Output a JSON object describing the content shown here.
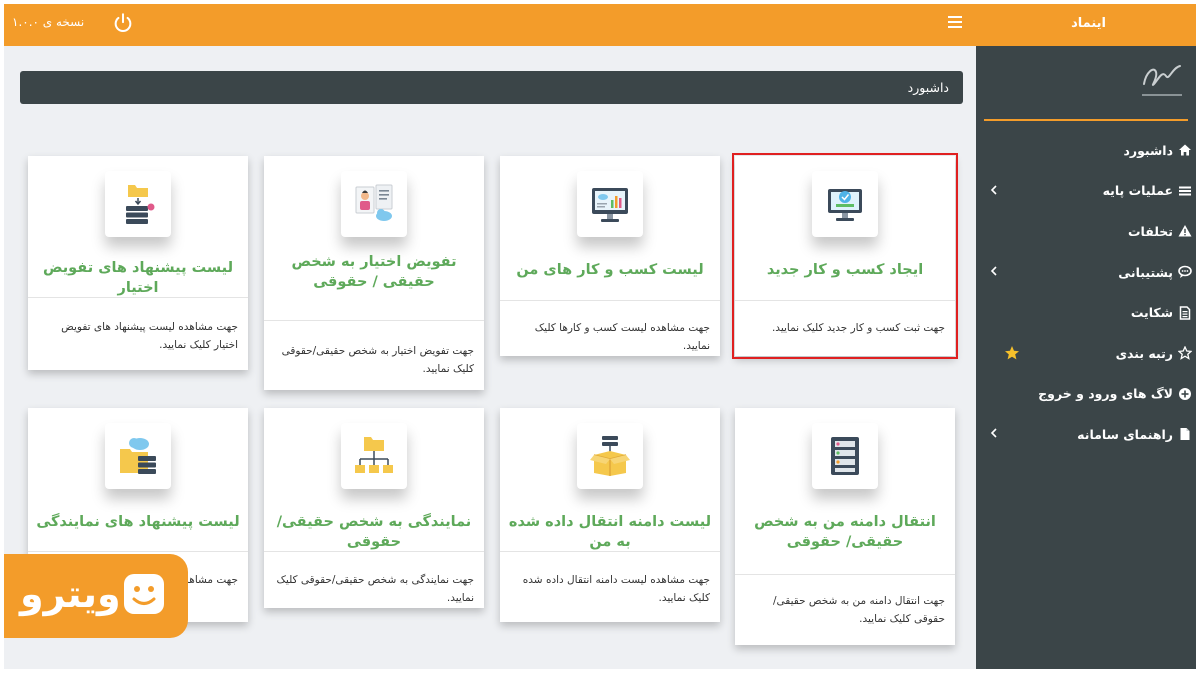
{
  "header": {
    "brand": "اینماد",
    "version": "نسخه ی ۱.۰.۰"
  },
  "sidebar": {
    "items": [
      {
        "label": "داشبورد",
        "icon": "home-icon",
        "has_chevron": false
      },
      {
        "label": "عملیات پایه",
        "icon": "list-icon",
        "has_chevron": true
      },
      {
        "label": "تخلفات",
        "icon": "warning-icon",
        "has_chevron": false
      },
      {
        "label": "پشتیبانی",
        "icon": "chat-icon",
        "has_chevron": true
      },
      {
        "label": "شکایت",
        "icon": "document-icon",
        "has_chevron": false
      },
      {
        "label": "رتبه بندی",
        "icon": "star-outline-icon",
        "has_chevron": false
      },
      {
        "label": "لاگ های ورود و خروج",
        "icon": "plus-circle-icon",
        "has_chevron": false
      },
      {
        "label": "راهنمای سامانه",
        "icon": "file-icon",
        "has_chevron": true
      }
    ]
  },
  "main": {
    "breadcrumb": "داشبورد",
    "cards": [
      {
        "title": "ایجاد کسب و کار جدید",
        "desc": "جهت ثبت کسب و کار جدید کلیک نمایید.",
        "icon": "new-business-monitor-icon"
      },
      {
        "title": "لیست کسب و کار های من",
        "desc": "جهت مشاهده لیست کسب و کارها کلیک نمایید.",
        "icon": "chart-monitor-icon"
      },
      {
        "title": "تفویض اختیار به شخص حقیقی / حقوقی",
        "desc": "جهت تفویض اختیار به شخص حقیقی/حقوقی کلیک نمایید.",
        "icon": "person-document-icon"
      },
      {
        "title": "لیست پیشنهاد های تفویض اختیار",
        "desc": "جهت مشاهده لیست پیشنهاد های تفویض اختیار کلیک نمایید.",
        "icon": "folder-server-icon"
      },
      {
        "title": "انتقال دامنه من به شخص حقیقی/ حقوقی",
        "desc": "جهت انتقال دامنه من به شخص حقیقی/حقوقی کلیک نمایید.",
        "icon": "server-list-icon"
      },
      {
        "title": "لیست دامنه انتقال داده شده به من",
        "desc": "جهت مشاهده لیست دامنه انتقال داده شده کلیک نمایید.",
        "icon": "box-server-icon"
      },
      {
        "title": "نمایندگی به شخص حقیقی/حقوقی",
        "desc": "جهت نمایندگی به شخص حقیقی/حقوقی کلیک نمایید.",
        "icon": "folder-network-icon"
      },
      {
        "title": "لیست پیشنهاد های نمایندگی",
        "desc": "جهت مشاهده",
        "icon": "folder-cloud-icon"
      }
    ]
  },
  "watermark": {
    "text": "ویترو"
  },
  "colors": {
    "accent": "#f39c2a",
    "sidebar": "#3b4548",
    "card_title": "#5ea95a",
    "highlight": "#e02020"
  }
}
